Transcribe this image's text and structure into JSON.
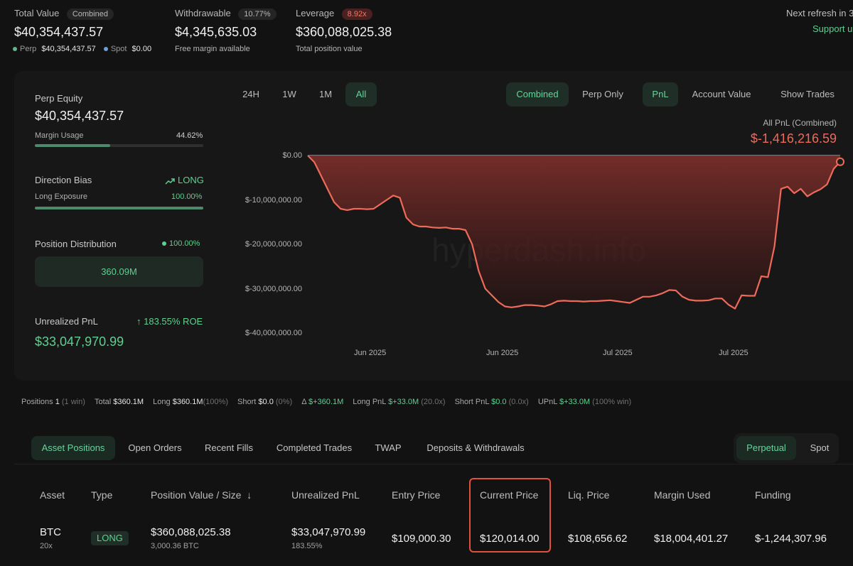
{
  "header": {
    "total_value": {
      "label": "Total Value",
      "badge": "Combined",
      "value": "$40,354,437.57",
      "perp_label": "Perp",
      "perp_value": "$40,354,437.57",
      "spot_label": "Spot",
      "spot_value": "$0.00"
    },
    "withdrawable": {
      "label": "Withdrawable",
      "badge": "10.77%",
      "value": "$4,345,635.03",
      "sub": "Free margin available"
    },
    "leverage": {
      "label": "Leverage",
      "badge": "8.92x",
      "value": "$360,088,025.38",
      "sub": "Total position value"
    },
    "refresh": "Next refresh in 3",
    "support": "Support u"
  },
  "left_panel": {
    "perp_equity_label": "Perp Equity",
    "perp_equity_value": "$40,354,437.57",
    "margin_usage_label": "Margin Usage",
    "margin_usage_value": "44.62%",
    "margin_usage_fraction": 0.4462,
    "direction_bias_label": "Direction Bias",
    "direction_bias_value": "LONG",
    "long_exposure_label": "Long Exposure",
    "long_exposure_value": "100.00%",
    "long_exposure_fraction": 1.0,
    "position_distribution_label": "Position Distribution",
    "position_distribution_value": "100.00%",
    "position_distribution_amount": "360.09M",
    "unrealized_pnl_label": "Unrealized PnL",
    "unrealized_pnl_roe": "183.55% ROE",
    "unrealized_pnl_value": "$33,047,970.99"
  },
  "chart_controls": {
    "ranges": [
      "24H",
      "1W",
      "1M",
      "All"
    ],
    "active_range": "All",
    "combined": "Combined",
    "perp_only": "Perp Only",
    "pnl": "PnL",
    "account_value": "Account Value",
    "show_trades": "Show Trades",
    "summary_label": "All PnL (Combined)",
    "summary_value": "$-1,416,216.59",
    "watermark": "hyperdash.info"
  },
  "chart_data": {
    "type": "area",
    "ylim": [
      -40000000,
      0
    ],
    "y_ticks": [
      "$0.00",
      "$-10,000,000.00",
      "$-20,000,000.00",
      "$-30,000,000.00",
      "$-40,000,000.00"
    ],
    "x_ticks": [
      "Jun 2025",
      "Jun 2025",
      "Jul 2025",
      "Jul 2025"
    ],
    "series": [
      {
        "values": [
          0,
          -1500000,
          -4500000,
          -7500000,
          -10500000,
          -12000000,
          -12300000,
          -12000000,
          -12000000,
          -12100000,
          -12000000,
          -11000000,
          -10000000,
          -9000000,
          -9500000,
          -14000000,
          -15500000,
          -16000000,
          -16000000,
          -16200000,
          -16300000,
          -16200000,
          -16500000,
          -16500000,
          -16800000,
          -20000000,
          -26000000,
          -30000000,
          -31500000,
          -33000000,
          -34000000,
          -34200000,
          -34000000,
          -33700000,
          -33700000,
          -33800000,
          -34000000,
          -33500000,
          -32800000,
          -32700000,
          -32800000,
          -32800000,
          -32900000,
          -32800000,
          -32800000,
          -32700000,
          -32600000,
          -32800000,
          -33000000,
          -33200000,
          -32500000,
          -31800000,
          -31800000,
          -31500000,
          -31000000,
          -30300000,
          -30400000,
          -31800000,
          -32500000,
          -32700000,
          -32700000,
          -32600000,
          -32200000,
          -32200000,
          -33600000,
          -34500000,
          -31500000,
          -31600000,
          -31600000,
          -27200000,
          -27400000,
          -20500000,
          -7500000,
          -7000000,
          -8500000,
          -7500000,
          -9200000,
          -8300000,
          -7600000,
          -6500000,
          -3000000,
          -1400000
        ]
      }
    ]
  },
  "positions_strip": {
    "positions_label": "Positions",
    "positions_count": "1",
    "positions_win": "(1 win)",
    "total_label": "Total",
    "total_value": "$360.1M",
    "long_label": "Long",
    "long_value": "$360.1M",
    "long_pct": "(100%)",
    "short_label": "Short",
    "short_value": "$0.0",
    "short_pct": "(0%)",
    "delta_label": "Δ",
    "delta_value": "$+360.1M",
    "long_pnl_label": "Long PnL",
    "long_pnl_value": "$+33.0M",
    "long_pnl_lev": "(20.0x)",
    "short_pnl_label": "Short PnL",
    "short_pnl_value": "$0.0",
    "short_pnl_lev": "(0.0x)",
    "upnl_label": "UPnL",
    "upnl_value": "$+33.0M",
    "upnl_win": "(100% win)"
  },
  "tabs": {
    "items": [
      "Asset Positions",
      "Open Orders",
      "Recent Fills",
      "Completed Trades",
      "TWAP",
      "Deposits & Withdrawals"
    ],
    "perpetual": "Perpetual",
    "spot": "Spot"
  },
  "table": {
    "headers": [
      "Asset",
      "Type",
      "Position Value / Size",
      "Unrealized PnL",
      "Entry Price",
      "Current Price",
      "Liq. Price",
      "Margin Used",
      "Funding"
    ],
    "sort_arrow": "↓",
    "row": {
      "asset": "BTC",
      "leverage": "20x",
      "type": "LONG",
      "position_value": "$360,088,025.38",
      "size": "3,000.36 BTC",
      "unrealized_pnl": "$33,047,970.99",
      "unrealized_pnl_pct": "183.55%",
      "entry_price": "$109,000.30",
      "current_price": "$120,014.00",
      "liq_price": "$108,656.62",
      "margin_used": "$18,004,401.27",
      "funding": "$-1,244,307.96"
    }
  },
  "colors": {
    "accent_green": "#5fd08f",
    "accent_red": "#ee6a5a",
    "highlight_box": "#e0523e"
  }
}
